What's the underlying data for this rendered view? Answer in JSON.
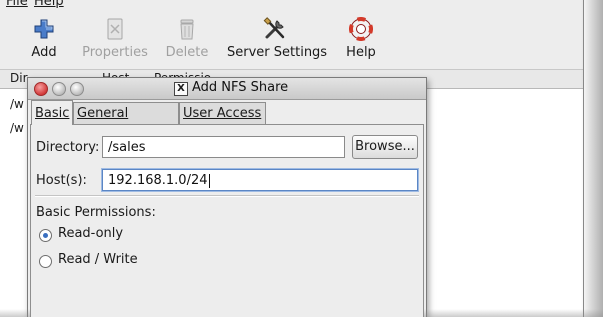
{
  "menubar": {
    "file": "File",
    "help": "Help"
  },
  "toolbar": {
    "add": "Add",
    "properties": "Properties",
    "delete": "Delete",
    "server_settings": "Server Settings",
    "help": "Help"
  },
  "list": {
    "header_col1": "Dir",
    "header_col2": "Host",
    "header_col3": "Permissio",
    "rows": [
      "/w",
      "/w"
    ]
  },
  "dialog": {
    "title": "Add NFS Share",
    "title_icon": "X",
    "tabs": [
      "Basic",
      "General Options",
      "User Access"
    ],
    "active_tab": "Basic",
    "directory_label": "Directory:",
    "directory_value": "/sales",
    "browse_label": "Browse...",
    "hosts_label": "Host(s):",
    "hosts_value": "192.168.1.0/24",
    "permissions_label": "Basic Permissions:",
    "radio_readonly": "Read-only",
    "radio_readwrite": "Read / Write",
    "selected_permission": "Read-only"
  },
  "colors": {
    "accent": "#3a6fc0",
    "focus_border": "#5b86c5",
    "close_button": "#d23a3a"
  }
}
